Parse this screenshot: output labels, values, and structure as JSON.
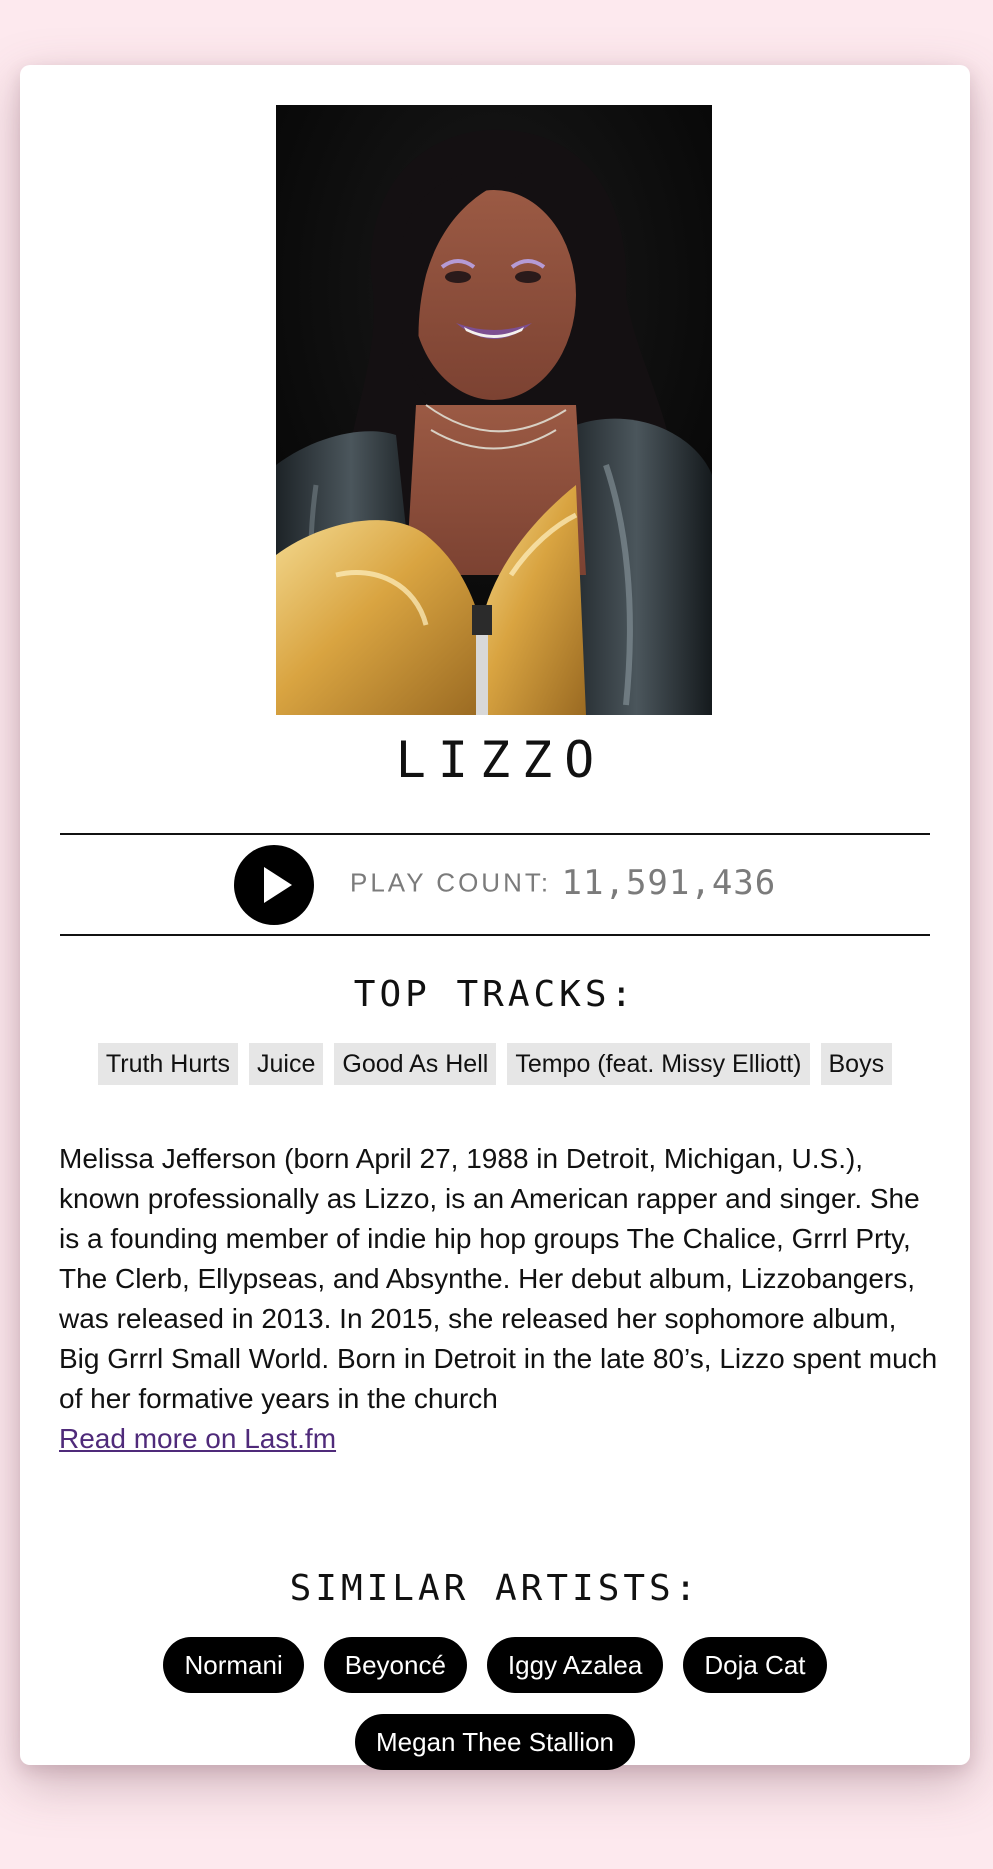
{
  "artist": {
    "name": "LIZZO",
    "photo_alt": "Lizzo"
  },
  "playcount": {
    "label": "PLAY COUNT:",
    "value": "11,591,436"
  },
  "top_tracks": {
    "title": "TOP TRACKS:",
    "items": [
      "Truth Hurts",
      "Juice",
      "Good As Hell",
      "Tempo (feat. Missy Elliott)",
      "Boys"
    ]
  },
  "bio": {
    "text": "Melissa Jefferson (born April 27, 1988 in Detroit, Michigan, U.S.), known professionally as Lizzo, is an American rapper and singer. She is a founding member of indie hip hop groups The Chalice, Grrrl Prty, The Clerb, Ellypseas, and Absynthe. Her debut album, Lizzobangers, was released in 2013. In 2015, she released her sophomore album, Big Grrrl Small World. Born in Detroit in the late 80’s, Lizzo spent much of her formative years in the church",
    "read_more": "Read more on Last.fm"
  },
  "similar_artists": {
    "title": "SIMILAR ARTISTS:",
    "items": [
      "Normani",
      "Beyoncé",
      "Iggy Azalea",
      "Doja Cat",
      "Megan Thee Stallion"
    ]
  },
  "icons": {
    "play": "play-icon"
  },
  "colors": {
    "background": "#fde9ee",
    "card": "#ffffff",
    "tag": "#e6e6e6",
    "pill": "#000000",
    "link": "#4f2a7a",
    "muted": "#7b7b7b"
  }
}
